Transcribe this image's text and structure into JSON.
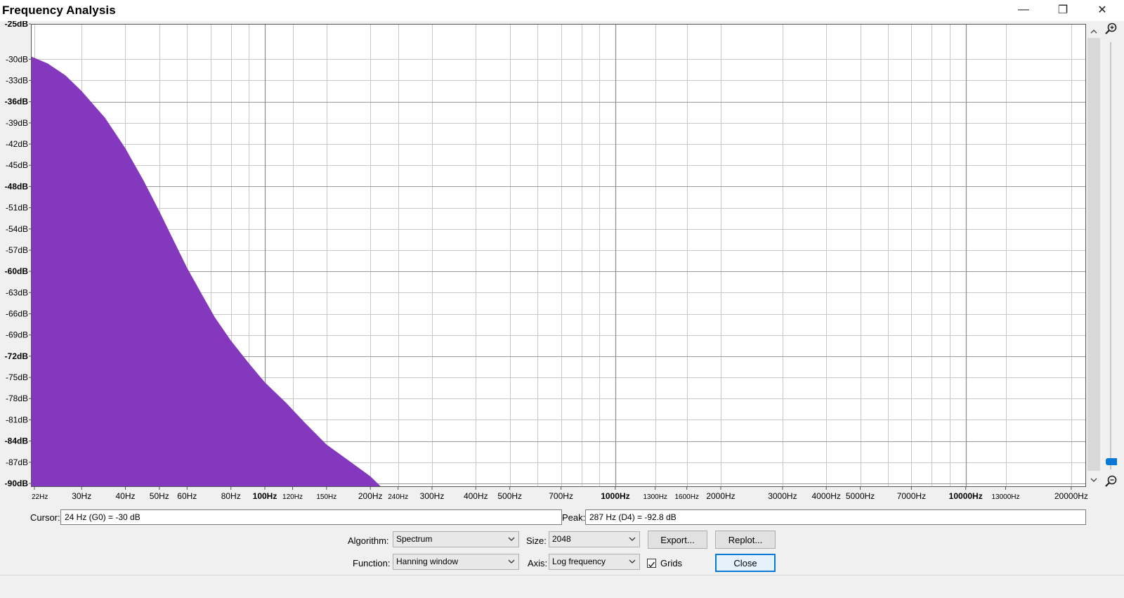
{
  "window": {
    "title": "Frequency Analysis",
    "minimize_glyph": "—",
    "restore_glyph": "❐",
    "close_glyph": "✕"
  },
  "plot": {
    "y_ticks": [
      {
        "label": "-25dB",
        "db": -25,
        "bold": true
      },
      {
        "label": "-30dB",
        "db": -30,
        "bold": false
      },
      {
        "label": "-33dB",
        "db": -33,
        "bold": false
      },
      {
        "label": "-36dB",
        "db": -36,
        "bold": true
      },
      {
        "label": "-39dB",
        "db": -39,
        "bold": false
      },
      {
        "label": "-42dB",
        "db": -42,
        "bold": false
      },
      {
        "label": "-45dB",
        "db": -45,
        "bold": false
      },
      {
        "label": "-48dB",
        "db": -48,
        "bold": true
      },
      {
        "label": "-51dB",
        "db": -51,
        "bold": false
      },
      {
        "label": "-54dB",
        "db": -54,
        "bold": false
      },
      {
        "label": "-57dB",
        "db": -57,
        "bold": false
      },
      {
        "label": "-60dB",
        "db": -60,
        "bold": true
      },
      {
        "label": "-63dB",
        "db": -63,
        "bold": false
      },
      {
        "label": "-66dB",
        "db": -66,
        "bold": false
      },
      {
        "label": "-69dB",
        "db": -69,
        "bold": false
      },
      {
        "label": "-72dB",
        "db": -72,
        "bold": true
      },
      {
        "label": "-75dB",
        "db": -75,
        "bold": false
      },
      {
        "label": "-78dB",
        "db": -78,
        "bold": false
      },
      {
        "label": "-81dB",
        "db": -81,
        "bold": false
      },
      {
        "label": "-84dB",
        "db": -84,
        "bold": true
      },
      {
        "label": "-87dB",
        "db": -87,
        "bold": false
      },
      {
        "label": "-90dB",
        "db": -90,
        "bold": true
      }
    ],
    "x_ticks": [
      {
        "label": "22Hz",
        "hz": 22,
        "size": "small",
        "bold": false
      },
      {
        "label": "30Hz",
        "hz": 30,
        "size": "normal",
        "bold": false
      },
      {
        "label": "40Hz",
        "hz": 40,
        "size": "normal",
        "bold": false
      },
      {
        "label": "50Hz",
        "hz": 50,
        "size": "normal",
        "bold": false
      },
      {
        "label": "60Hz",
        "hz": 60,
        "size": "normal",
        "bold": false
      },
      {
        "label": "80Hz",
        "hz": 80,
        "size": "normal",
        "bold": false
      },
      {
        "label": "100Hz",
        "hz": 100,
        "size": "normal",
        "bold": true
      },
      {
        "label": "120Hz",
        "hz": 120,
        "size": "small",
        "bold": false
      },
      {
        "label": "150Hz",
        "hz": 150,
        "size": "small",
        "bold": false
      },
      {
        "label": "200Hz",
        "hz": 200,
        "size": "normal",
        "bold": false
      },
      {
        "label": "240Hz",
        "hz": 240,
        "size": "small",
        "bold": false
      },
      {
        "label": "300Hz",
        "hz": 300,
        "size": "normal",
        "bold": false
      },
      {
        "label": "400Hz",
        "hz": 400,
        "size": "normal",
        "bold": false
      },
      {
        "label": "500Hz",
        "hz": 500,
        "size": "normal",
        "bold": false
      },
      {
        "label": "700Hz",
        "hz": 700,
        "size": "normal",
        "bold": false
      },
      {
        "label": "1000Hz",
        "hz": 1000,
        "size": "normal",
        "bold": true
      },
      {
        "label": "1300Hz",
        "hz": 1300,
        "size": "small",
        "bold": false
      },
      {
        "label": "1600Hz",
        "hz": 1600,
        "size": "small",
        "bold": false
      },
      {
        "label": "2000Hz",
        "hz": 2000,
        "size": "normal",
        "bold": false
      },
      {
        "label": "3000Hz",
        "hz": 3000,
        "size": "normal",
        "bold": false
      },
      {
        "label": "4000Hz",
        "hz": 4000,
        "size": "normal",
        "bold": false
      },
      {
        "label": "5000Hz",
        "hz": 5000,
        "size": "normal",
        "bold": false
      },
      {
        "label": "7000Hz",
        "hz": 7000,
        "size": "normal",
        "bold": false
      },
      {
        "label": "10000Hz",
        "hz": 10000,
        "size": "normal",
        "bold": true
      },
      {
        "label": "13000Hz",
        "hz": 13000,
        "size": "small",
        "bold": false
      },
      {
        "label": "20000Hz",
        "hz": 20000,
        "size": "normal",
        "bold": false
      }
    ],
    "x_range_hz": [
      21.5,
      22050
    ],
    "y_range_db": [
      -25,
      -90.5
    ],
    "grid": true,
    "axis": "log",
    "fill_color": "#8438be",
    "spectrum": [
      {
        "hz": 21.5,
        "db": -29.6
      },
      {
        "hz": 24,
        "db": -30.6
      },
      {
        "hz": 27,
        "db": -32.3
      },
      {
        "hz": 30,
        "db": -34.5
      },
      {
        "hz": 35,
        "db": -38.3
      },
      {
        "hz": 40,
        "db": -42.6
      },
      {
        "hz": 45,
        "db": -47.1
      },
      {
        "hz": 50,
        "db": -51.5
      },
      {
        "hz": 55,
        "db": -55.7
      },
      {
        "hz": 60,
        "db": -59.5
      },
      {
        "hz": 66,
        "db": -63.2
      },
      {
        "hz": 72,
        "db": -66.5
      },
      {
        "hz": 80,
        "db": -69.8
      },
      {
        "hz": 90,
        "db": -73.0
      },
      {
        "hz": 100,
        "db": -75.7
      },
      {
        "hz": 115,
        "db": -78.6
      },
      {
        "hz": 130,
        "db": -81.4
      },
      {
        "hz": 150,
        "db": -84.5
      },
      {
        "hz": 175,
        "db": -86.9
      },
      {
        "hz": 200,
        "db": -89.0
      },
      {
        "hz": 215,
        "db": -90.5
      }
    ]
  },
  "cursor": {
    "label": "Cursor:",
    "value": "24 Hz (G0) = -30 dB"
  },
  "peak": {
    "label": "Peak:",
    "value": "287 Hz (D4) = -92.8 dB"
  },
  "controls": {
    "algorithm_label": "Algorithm:",
    "algorithm_value": "Spectrum",
    "size_label": "Size:",
    "size_value": "2048",
    "function_label": "Function:",
    "function_value": "Hanning window",
    "axis_label": "Axis:",
    "axis_value": "Log frequency",
    "export_label": "Export...",
    "replot_label": "Replot...",
    "grids_label": "Grids",
    "grids_checked": true,
    "close_label": "Close"
  },
  "icons": {
    "zoom_in": "zoom-in-icon",
    "zoom_out": "zoom-out-icon",
    "scroll_up": "chevron-up-icon",
    "scroll_down": "chevron-down-icon"
  }
}
